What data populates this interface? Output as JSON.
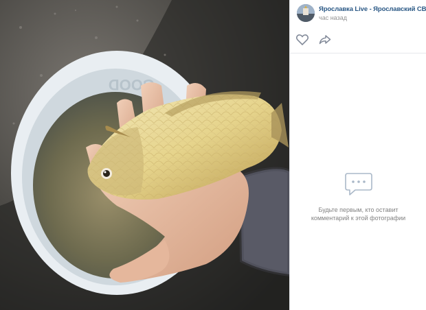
{
  "post": {
    "author": "Ярославка Live - Ярославский СВАО",
    "time": "час назад"
  },
  "actions": {
    "like_icon": "heart-outline-icon",
    "share_icon": "share-arrow-icon"
  },
  "comments": {
    "empty_icon": "comment-bubble-icon",
    "empty_text": "Будьте первым, кто оставит комментарий к этой фотографии"
  },
  "photo": {
    "bucket_lettering": "GOOD"
  },
  "colors": {
    "link": "#2a5885",
    "muted": "#939393",
    "icon": "#aab8c8",
    "divider": "#e7e8ec"
  }
}
